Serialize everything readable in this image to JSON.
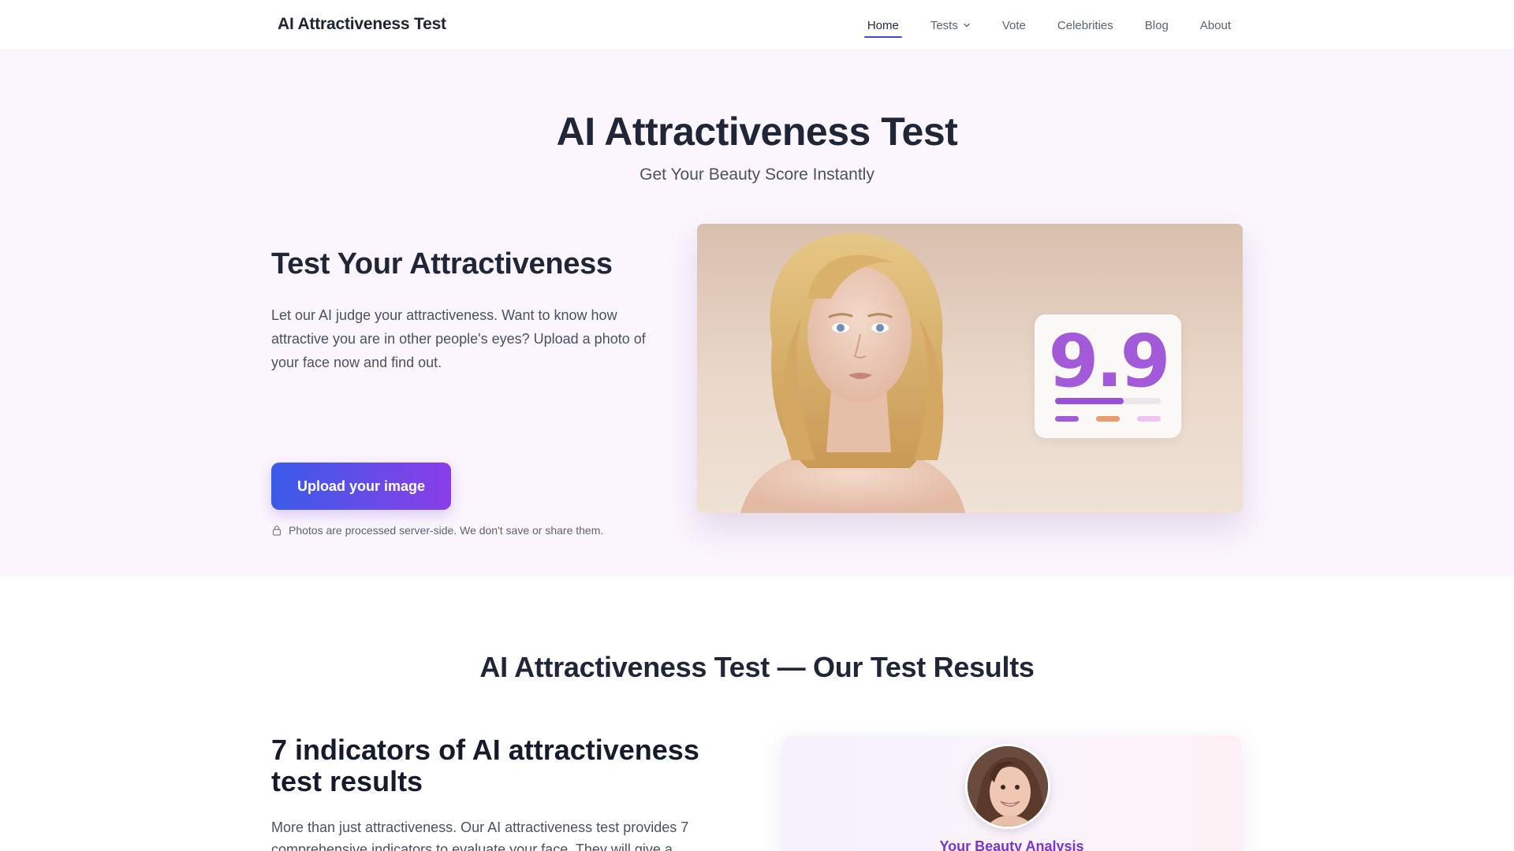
{
  "navbar": {
    "brand": "AI Attractiveness Test",
    "links": [
      {
        "label": "Home",
        "active": true
      },
      {
        "label": "Tests",
        "dropdown": true
      },
      {
        "label": "Vote"
      },
      {
        "label": "Celebrities"
      },
      {
        "label": "Blog"
      },
      {
        "label": "About"
      }
    ]
  },
  "hero": {
    "title": "AI Attractiveness Test",
    "subtitle": "Get Your Beauty Score Instantly",
    "heading": "Test Your Attractiveness",
    "description": "Let our AI judge your attractiveness. Want to know how attractive you are in other people's eyes? Upload a photo of your face now and find out.",
    "upload_label": "Upload your image",
    "privacy_note": "Photos are processed server-side. We don't save or share them.",
    "privacy_icon": "lock-icon",
    "score_card": {
      "score": "9.9",
      "progress": 0.65
    }
  },
  "results": {
    "section_title": "AI Attractiveness Test — Our Test Results",
    "indicators_heading": "7 indicators of AI attractiveness test results",
    "indicators_desc": "More than just attractiveness. Our AI attractiveness test provides 7 comprehensive indicators to evaluate your face. They will give a",
    "analysis_card_title": "Your Beauty Analysis"
  },
  "colors": {
    "accent": "#3b4bd8",
    "gradient_start": "#3a5be8",
    "gradient_end": "#8a3ee8",
    "score_purple": "#a35ad8",
    "hero_bg": "#fbf5fd"
  }
}
